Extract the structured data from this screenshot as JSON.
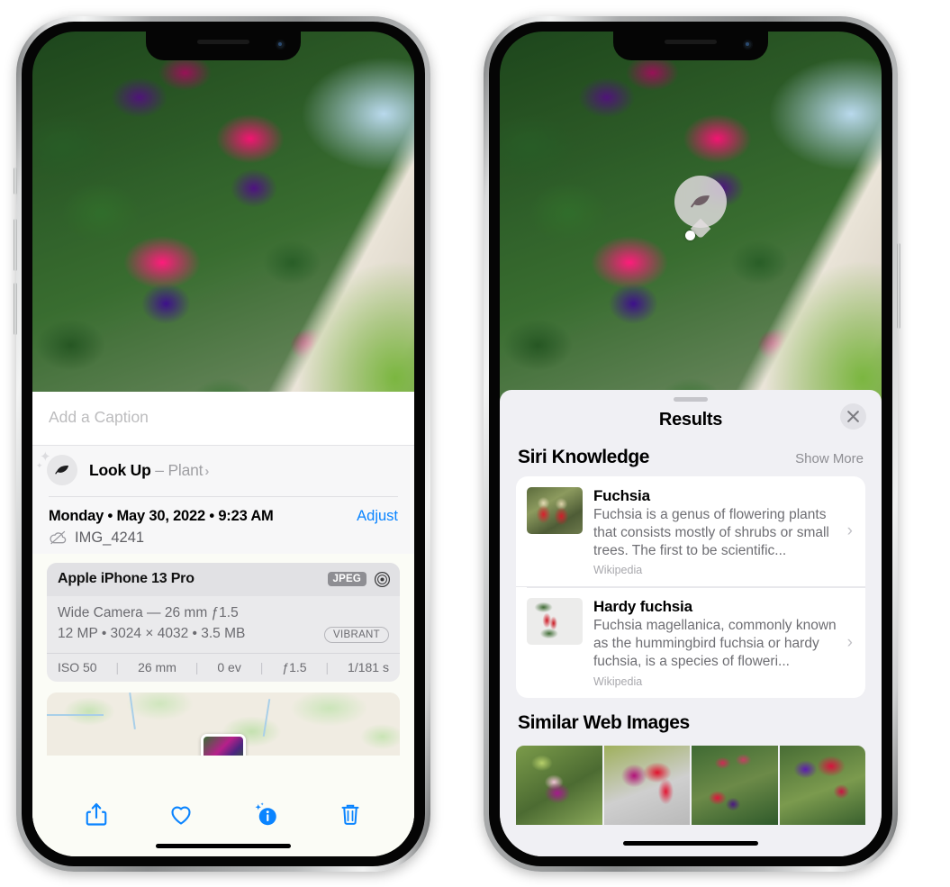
{
  "left_phone": {
    "caption": {
      "placeholder": "Add a Caption",
      "value": ""
    },
    "lookup": {
      "label": "Look Up",
      "dash": " – ",
      "subject": "Plant",
      "chevron": "›",
      "icon": "leaf-icon"
    },
    "info": {
      "date": "Monday • May 30, 2022 • 9:23 AM",
      "adjust_label": "Adjust",
      "filename": "IMG_4241",
      "cloud_icon": "icloud-slash-icon"
    },
    "camera_card": {
      "device": "Apple iPhone 13 Pro",
      "format_badge": "JPEG",
      "aperture_icon": "aperture-icon",
      "lens_line": "Wide Camera — 26 mm ƒ1.5",
      "size_line": "12 MP • 3024 × 4032 • 3.5 MB",
      "style_badge": "VIBRANT",
      "exif": [
        "ISO 50",
        "26 mm",
        "0 ev",
        "ƒ1.5",
        "1/181 s"
      ]
    },
    "toolbar": {
      "share_label": "share-icon",
      "favorite_label": "heart-icon",
      "info_label": "info-sparkle-icon",
      "delete_label": "trash-icon"
    }
  },
  "right_phone": {
    "visual_lookup_badge": {
      "icon": "leaf-icon"
    },
    "sheet": {
      "title": "Results",
      "close_label": "✕"
    },
    "siri_knowledge": {
      "section_title": "Siri Knowledge",
      "show_more": "Show More",
      "cards": [
        {
          "title": "Fuchsia",
          "description": "Fuchsia is a genus of flowering plants that consists mostly of shrubs or small trees. The first to be scientific...",
          "source": "Wikipedia",
          "chevron": "›"
        },
        {
          "title": "Hardy fuchsia",
          "description": "Fuchsia magellanica, commonly known as the hummingbird fuchsia or hardy fuchsia, is a species of floweri...",
          "source": "Wikipedia",
          "chevron": "›"
        }
      ]
    },
    "similar_web_images": {
      "section_title": "Similar Web Images",
      "count": 4
    }
  },
  "colors": {
    "accent_blue": "#0a84ff",
    "sheet_bg": "#f0f0f4",
    "card_bg": "#ffffff",
    "secondary_text": "#6e6e73",
    "tertiary_text": "#a8a8ad"
  }
}
